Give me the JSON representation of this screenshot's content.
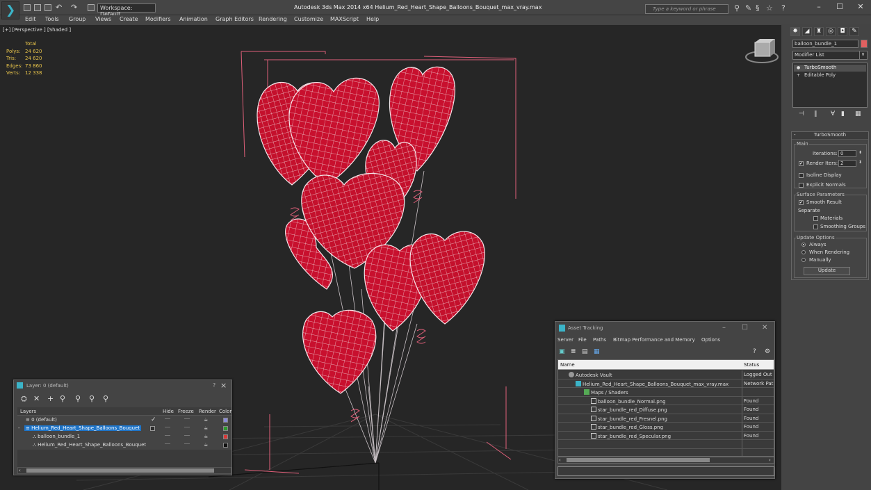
{
  "titlebar": {
    "workspace": "Workspace: Default",
    "app_title": "Autodesk 3ds Max  2014 x64     Helium_Red_Heart_Shape_Balloons_Bouquet_max_vray.max",
    "search_placeholder": "Type a keyword or phrase"
  },
  "menu": [
    "Edit",
    "Tools",
    "Group",
    "Views",
    "Create",
    "Modifiers",
    "Animation",
    "Graph Editors",
    "Rendering",
    "Customize",
    "MAXScript",
    "Help"
  ],
  "viewport": {
    "label": "[+] [Perspective ] [Shaded ]",
    "stats": {
      "header": "Total",
      "polys_label": "Polys:",
      "polys": "24 620",
      "tris_label": "Tris:",
      "tris": "24 620",
      "edges_label": "Edges:",
      "edges": "73 860",
      "verts_label": "Verts:",
      "verts": "12 338"
    }
  },
  "command_panel": {
    "object_name": "balloon_bundle_1",
    "object_color": "#e06060",
    "modifier_list": "Modifier List",
    "stack": [
      "TurboSmooth",
      "Editable Poly"
    ],
    "rollout": {
      "title": "TurboSmooth",
      "main_group": "Main",
      "iterations_label": "Iterations:",
      "iterations": "0",
      "render_iters_label": "Render Iters:",
      "render_iters": "2",
      "isoline": "Isoline Display",
      "explicit_normals": "Explicit Normals",
      "surface_group": "Surface Parameters",
      "smooth_result": "Smooth Result",
      "separate": "Separate",
      "materials": "Materials",
      "smoothing_groups": "Smoothing Groups",
      "update_group": "Update Options",
      "always": "Always",
      "when_rendering": "When Rendering",
      "manually": "Manually",
      "update_button": "Update"
    }
  },
  "layer_window": {
    "title": "Layer: 0 (default)",
    "help": "?",
    "columns": [
      "Layers",
      "Hide",
      "Freeze",
      "Render",
      "Color"
    ],
    "rows": [
      {
        "name": "0 (default)",
        "color": "#8a8ad8"
      },
      {
        "name": "Helium_Red_Heart_Shape_Balloons_Bouquet",
        "color": "#2e9a2e"
      },
      {
        "name": "balloon_bundle_1",
        "color": "#d83838"
      },
      {
        "name": "Helium_Red_Heart_Shape_Balloons_Bouquet",
        "color": "#111111"
      }
    ]
  },
  "asset_window": {
    "title": "Asset Tracking",
    "menu": [
      "Server",
      "File",
      "Paths",
      "Bitmap Performance and Memory",
      "Options"
    ],
    "columns": [
      "Name",
      "Status"
    ],
    "rows": [
      {
        "name": "Autodesk Vault",
        "status": "Logged Out"
      },
      {
        "name": "Helium_Red_Heart_Shape_Balloons_Bouquet_max_vray.max",
        "status": "Network Path"
      },
      {
        "name": "Maps / Shaders",
        "status": ""
      },
      {
        "name": "balloon_bundle_Normal.png",
        "status": "Found"
      },
      {
        "name": "star_bundle_red_Diffuse.png",
        "status": "Found"
      },
      {
        "name": "star_bundle_red_Fresnel.png",
        "status": "Found"
      },
      {
        "name": "star_bundle_red_Gloss.png",
        "status": "Found"
      },
      {
        "name": "star_bundle_red_Specular.png",
        "status": "Found"
      }
    ]
  }
}
